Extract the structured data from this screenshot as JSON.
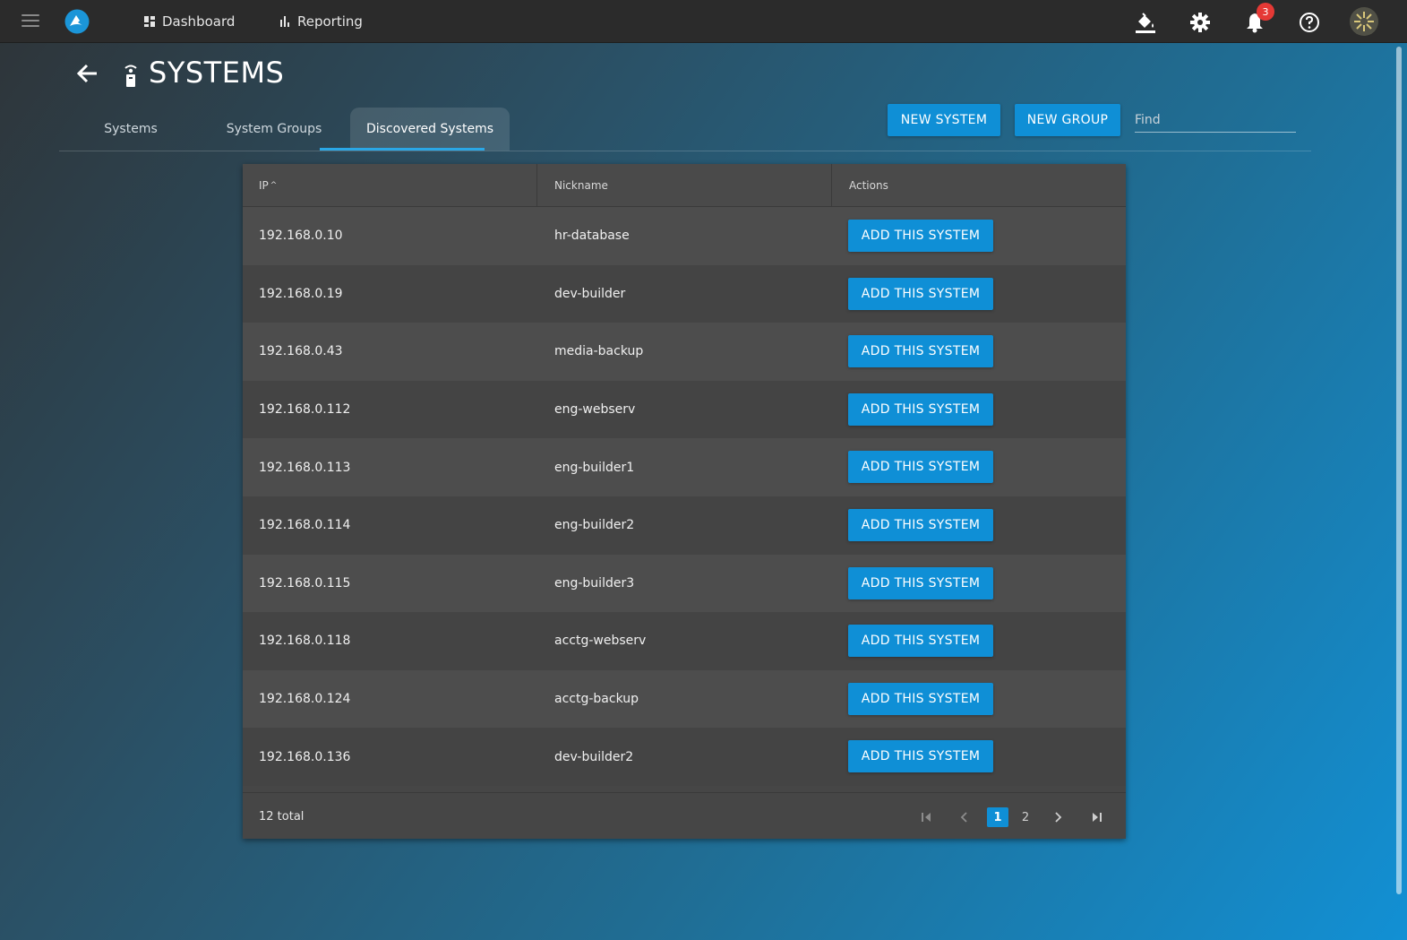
{
  "topbar": {
    "nav": [
      {
        "label": "Dashboard",
        "icon": "dashboard-icon"
      },
      {
        "label": "Reporting",
        "icon": "bar-chart-icon"
      }
    ],
    "notification_count": "3",
    "colors": {
      "bar": "#2b2b2b",
      "badge": "#e53935"
    }
  },
  "header": {
    "title": "SYSTEMS"
  },
  "tabs": [
    {
      "label": "Systems",
      "active": false
    },
    {
      "label": "System Groups",
      "active": false
    },
    {
      "label": "Discovered Systems",
      "active": true
    }
  ],
  "toolbar": {
    "new_system_label": "NEW SYSTEM",
    "new_group_label": "NEW GROUP",
    "find_placeholder": "Find"
  },
  "table": {
    "columns": [
      "IP",
      "Nickname",
      "Actions"
    ],
    "sort_indicator": "^",
    "action_label": "ADD THIS SYSTEM",
    "rows": [
      {
        "ip": "192.168.0.10",
        "nickname": "hr-database"
      },
      {
        "ip": "192.168.0.19",
        "nickname": "dev-builder"
      },
      {
        "ip": "192.168.0.43",
        "nickname": "media-backup"
      },
      {
        "ip": "192.168.0.112",
        "nickname": "eng-webserv"
      },
      {
        "ip": "192.168.0.113",
        "nickname": "eng-builder1"
      },
      {
        "ip": "192.168.0.114",
        "nickname": "eng-builder2"
      },
      {
        "ip": "192.168.0.115",
        "nickname": "eng-builder3"
      },
      {
        "ip": "192.168.0.118",
        "nickname": "acctg-webserv"
      },
      {
        "ip": "192.168.0.124",
        "nickname": "acctg-backup"
      },
      {
        "ip": "192.168.0.136",
        "nickname": "dev-builder2"
      }
    ],
    "total_label": "12 total",
    "pages": [
      "1",
      "2"
    ],
    "current_page": "1"
  },
  "colors": {
    "accent": "#0f8fd6",
    "tab_underline": "#2aa7e6",
    "card": "#464646"
  }
}
